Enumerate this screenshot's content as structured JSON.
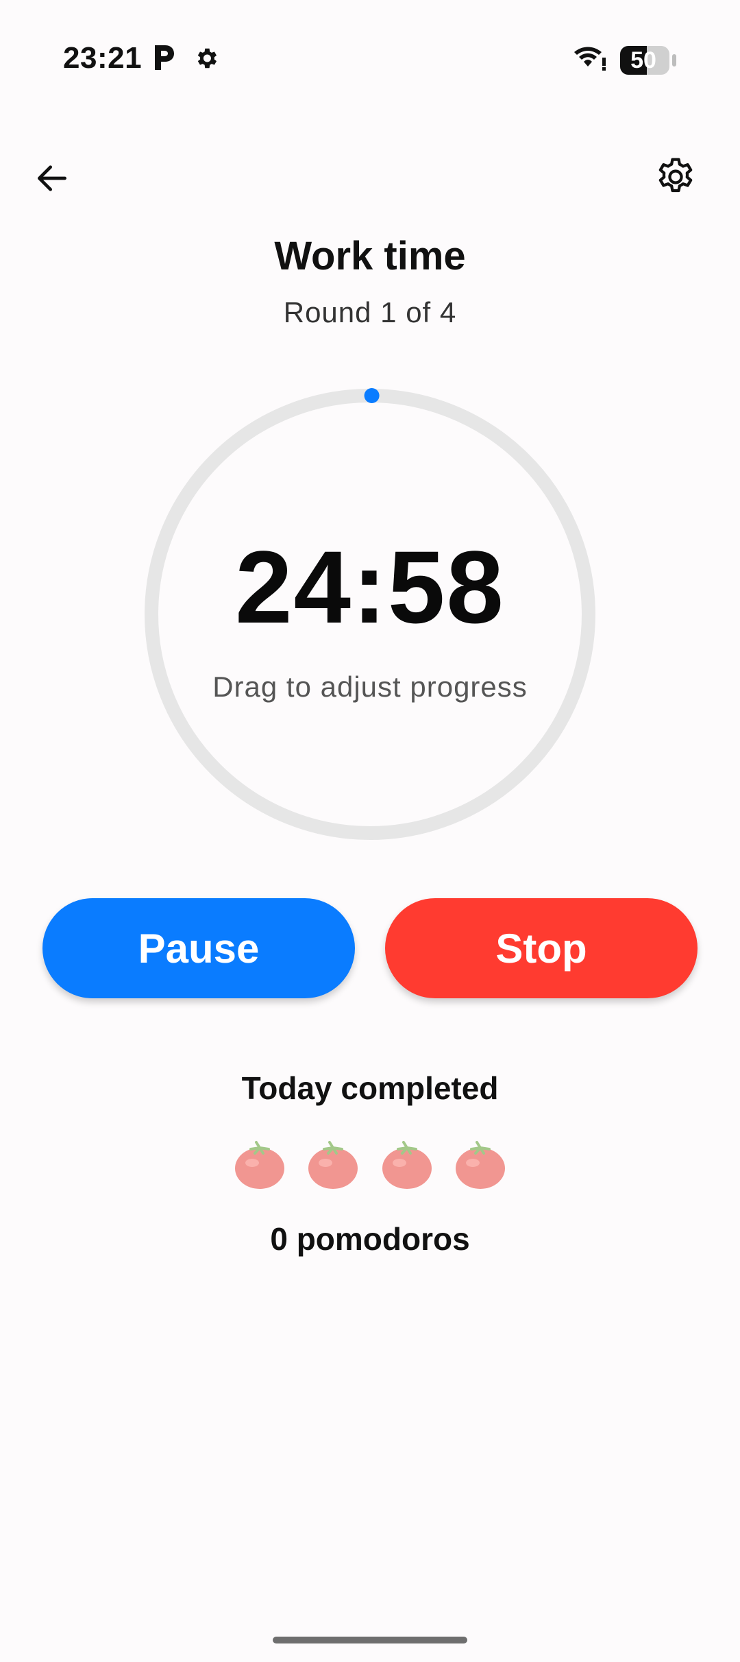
{
  "status_bar": {
    "time": "23:21",
    "battery_level": "50",
    "icons": [
      "parking-icon",
      "gear-icon",
      "wifi-icon",
      "battery-icon"
    ]
  },
  "header": {
    "back_icon": "arrow-left-icon",
    "settings_icon": "gear-icon",
    "title": "Work time",
    "round": "Round 1 of 4"
  },
  "timer": {
    "time_remaining": "24:58",
    "hint": "Drag to adjust progress",
    "progress_fraction": 0.0013
  },
  "actions": {
    "pause_label": "Pause",
    "stop_label": "Stop"
  },
  "summary": {
    "label": "Today completed",
    "tomato_icon": "tomato-icon",
    "tomato_count": 4,
    "count_text": "0 pomodoros"
  },
  "colors": {
    "accent_blue": "#0a7cff",
    "stop_red": "#ff3b30",
    "ring_track": "#e6e6e6",
    "background": "#fdfbfc"
  }
}
